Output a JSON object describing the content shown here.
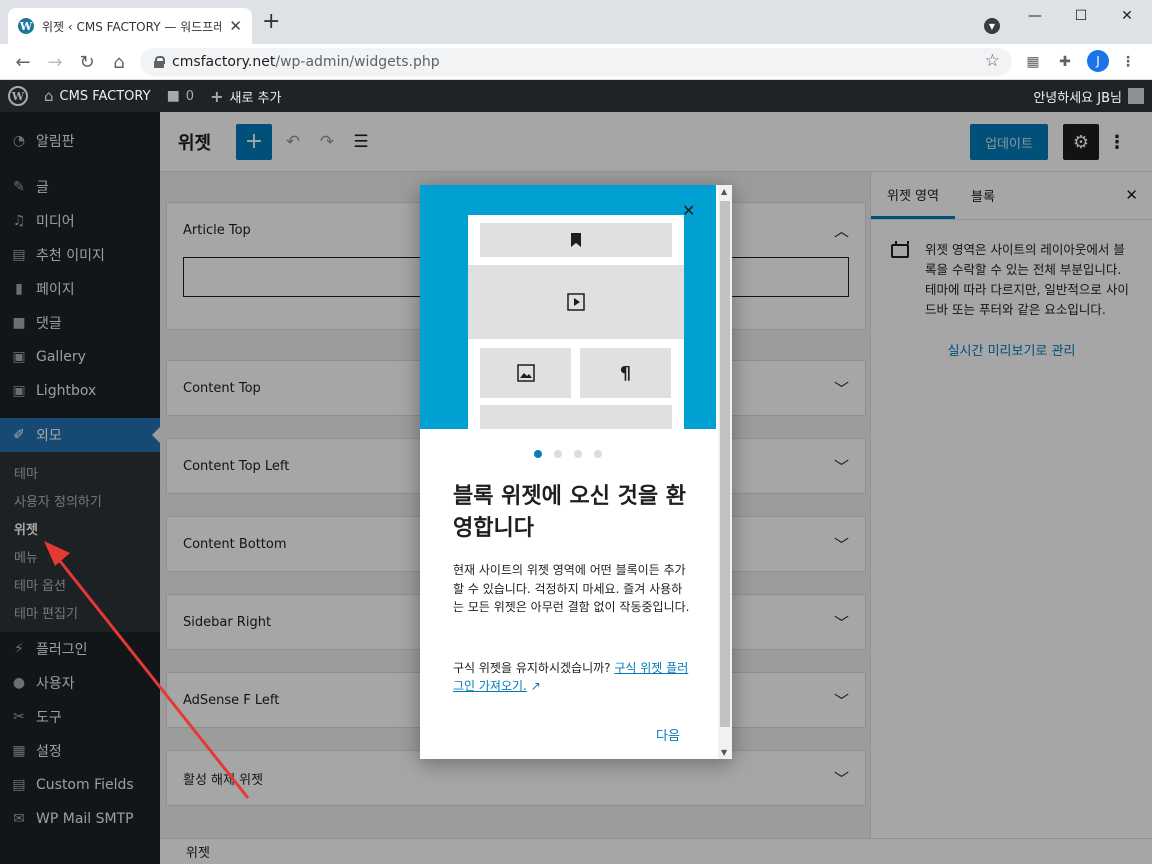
{
  "browser": {
    "tab_title": "위젯 ‹ CMS FACTORY — 워드프레스",
    "tab_close": "✕",
    "new_tab": "+",
    "url_domain": "cmsfactory.net",
    "url_path": "/wp-admin/widgets.php",
    "profile_initial": "J"
  },
  "adminbar": {
    "site_name": "CMS FACTORY",
    "comments_count": "0",
    "new_label": "새로 추가",
    "greeting": "안녕하세요 JB님"
  },
  "sidebar": {
    "items_top": [
      {
        "label": "알림판",
        "icon": "dashboard-icon"
      },
      {
        "label": "글",
        "icon": "pin-icon"
      },
      {
        "label": "미디어",
        "icon": "media-icon"
      },
      {
        "label": "추천 이미지",
        "icon": "image-icon"
      },
      {
        "label": "페이지",
        "icon": "page-icon"
      },
      {
        "label": "댓글",
        "icon": "comment-icon"
      },
      {
        "label": "Gallery",
        "icon": "gallery-icon"
      },
      {
        "label": "Lightbox",
        "icon": "lightbox-icon"
      }
    ],
    "current": {
      "label": "외모",
      "icon": "brush-icon"
    },
    "submenu": [
      "테마",
      "사용자 정의하기",
      "위젯",
      "메뉴",
      "테마 옵션",
      "테마 편집기"
    ],
    "items_bottom": [
      {
        "label": "플러그인",
        "icon": "plugin-icon"
      },
      {
        "label": "사용자",
        "icon": "user-icon"
      },
      {
        "label": "도구",
        "icon": "wrench-icon"
      },
      {
        "label": "설정",
        "icon": "settings-icon"
      },
      {
        "label": "Custom Fields",
        "icon": "fields-icon"
      },
      {
        "label": "WP Mail SMTP",
        "icon": "mail-icon"
      }
    ]
  },
  "header": {
    "title": "위젯",
    "update_label": "업데이트"
  },
  "areas": [
    {
      "name": "Article Top",
      "expanded": true
    },
    {
      "name": "Content Top",
      "expanded": false
    },
    {
      "name": "Content Top Left",
      "expanded": false
    },
    {
      "name": "Content Bottom",
      "expanded": false
    },
    {
      "name": "Sidebar Right",
      "expanded": false
    },
    {
      "name": "AdSense F Left",
      "expanded": false
    },
    {
      "name": "활성 해제 위젯",
      "expanded": false
    }
  ],
  "inspector": {
    "tab_area": "위젯 영역",
    "tab_block": "블록",
    "description": "위젯 영역은 사이트의 레이아웃에서 블록을 수락할 수 있는 전체 부분입니다. 테마에 따라 다르지만, 일반적으로 사이드바 또는 푸터와 같은 요소입니다.",
    "live_preview_link": "실시간 미리보기로 관리"
  },
  "footer": {
    "breadcrumb": "위젯"
  },
  "modal": {
    "heading": "블록 위젯에 오신 것을 환영합니다",
    "body": "현재 사이트의 위젯 영역에 어떤 블록이든 추가할 수 있습니다. 걱정하지 마세요. 즐겨 사용하는 모든 위젯은 아무런 결함 없이 작동중입니다.",
    "legacy_question": "구식 위젯을 유지하시겠습니까?",
    "legacy_link": "구식 위젯 플러그인 가져오기.",
    "next_label": "다음",
    "page_current": 1,
    "page_total": 4
  },
  "colors": {
    "admin_dark": "#1d2327",
    "wp_blue": "#2271b1",
    "gutenberg_blue": "#007cba",
    "hero_blue": "#00a0d2",
    "arrow_red": "#e53935"
  }
}
